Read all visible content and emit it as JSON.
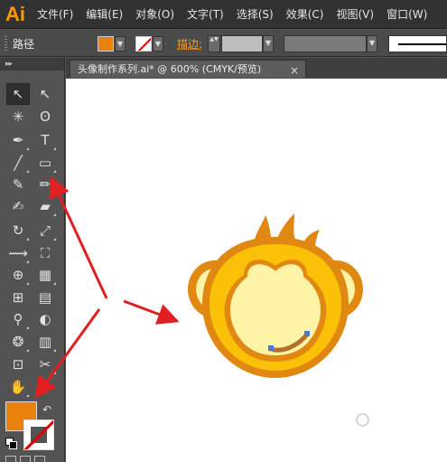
{
  "app": {
    "logo": "Ai"
  },
  "menu": [
    {
      "label": "文件(F)"
    },
    {
      "label": "编辑(E)"
    },
    {
      "label": "对象(O)"
    },
    {
      "label": "文字(T)"
    },
    {
      "label": "选择(S)"
    },
    {
      "label": "效果(C)"
    },
    {
      "label": "视图(V)"
    },
    {
      "label": "窗口(W)"
    }
  ],
  "control_bar": {
    "selection_label": "路径",
    "fill_color": "#e8820c",
    "stroke_color": "none",
    "stroke_label": "描边:",
    "dropdown_glyph": "▼",
    "stepper_glyph": "▲▼"
  },
  "tools_panel": {
    "header": "▸▸",
    "tools": [
      {
        "name": "selection-tool",
        "glyph": "↖",
        "active": true
      },
      {
        "name": "direct-selection-tool",
        "glyph": "↖"
      },
      {
        "name": "magic-wand-tool",
        "glyph": "✳"
      },
      {
        "name": "lasso-tool",
        "glyph": "ʘ"
      },
      {
        "name": "pen-tool",
        "glyph": "✒"
      },
      {
        "name": "type-tool",
        "glyph": "T"
      },
      {
        "name": "line-segment-tool",
        "glyph": "╱"
      },
      {
        "name": "rectangle-tool",
        "glyph": "▭"
      },
      {
        "name": "paintbrush-tool",
        "glyph": "✎"
      },
      {
        "name": "pencil-tool",
        "glyph": "✏"
      },
      {
        "name": "blob-brush-tool",
        "glyph": "✍"
      },
      {
        "name": "eraser-tool",
        "glyph": "▰"
      },
      {
        "name": "rotate-tool",
        "glyph": "↻"
      },
      {
        "name": "scale-tool",
        "glyph": "⤢"
      },
      {
        "name": "width-tool",
        "glyph": "⟿"
      },
      {
        "name": "free-transform-tool",
        "glyph": "⛶"
      },
      {
        "name": "shape-builder-tool",
        "glyph": "⊕"
      },
      {
        "name": "perspective-grid-tool",
        "glyph": "▦"
      },
      {
        "name": "mesh-tool",
        "glyph": "⊞"
      },
      {
        "name": "gradient-tool",
        "glyph": "▤"
      },
      {
        "name": "eyedropper-tool",
        "glyph": "⚲"
      },
      {
        "name": "blend-tool",
        "glyph": "◐"
      },
      {
        "name": "symbol-sprayer-tool",
        "glyph": "❂"
      },
      {
        "name": "column-graph-tool",
        "glyph": "▥"
      },
      {
        "name": "artboard-tool",
        "glyph": "⊡"
      },
      {
        "name": "slice-tool",
        "glyph": "✂"
      },
      {
        "name": "hand-tool",
        "glyph": "✋"
      },
      {
        "name": "zoom-tool",
        "glyph": "⚲"
      }
    ],
    "fill_color": "#e8820c",
    "stroke_color": "none",
    "swap_glyph": "↶"
  },
  "document": {
    "tab_title": "头像制作系列.ai* @ 600% (CMYK/预览)",
    "close_glyph": "×"
  },
  "artwork": {
    "colors": {
      "dark_orange": "#e08812",
      "yellow": "#fbc108",
      "light": "#fff3a6",
      "mouth": "#b5702a",
      "anchor": "#4a78d8"
    }
  },
  "annotations": {
    "arrow_color": "#e02020"
  }
}
